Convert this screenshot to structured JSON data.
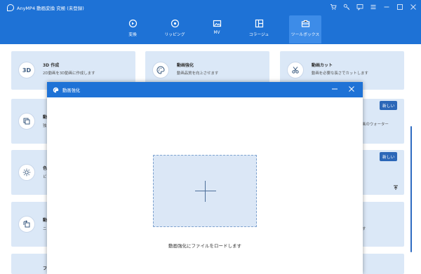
{
  "app": {
    "title": "AnyMP4 動画変換 究極 (未登録)"
  },
  "nav": {
    "tabs": [
      {
        "label": "変換",
        "icon": "convert-icon"
      },
      {
        "label": "リッピング",
        "icon": "disc-icon"
      },
      {
        "label": "MV",
        "icon": "image-icon"
      },
      {
        "label": "コラージュ",
        "icon": "collage-icon"
      },
      {
        "label": "ツールボックス",
        "icon": "toolbox-icon",
        "active": true
      }
    ]
  },
  "cards": {
    "c3d": {
      "title": "3D 作成",
      "desc": "2D動画を3D動画に作成します",
      "icon_text": "3D"
    },
    "enhance": {
      "title": "動画強化",
      "desc": "動画品質を向上させます"
    },
    "cut": {
      "title": "動画カット",
      "desc": "動画を必要な長さでカットします"
    },
    "left2": {
      "title": "動",
      "desc": "独"
    },
    "right2": {
      "desc": "画のウォーター",
      "badge": "新しい"
    },
    "left3": {
      "title": "色",
      "desc": "ビ"
    },
    "right3": {
      "badge": "新しい"
    },
    "left4": {
      "title": "動",
      "desc": "ニ"
    },
    "right4": {
      "desc": "す"
    },
    "left5": {
      "title": "ファ"
    }
  },
  "dialog": {
    "title": "動画強化",
    "drop_label": "動画強化にファイルをロードします"
  },
  "colors": {
    "header": "#1e72d6",
    "card": "#dbe8f7",
    "badge": "#2b67b8"
  }
}
